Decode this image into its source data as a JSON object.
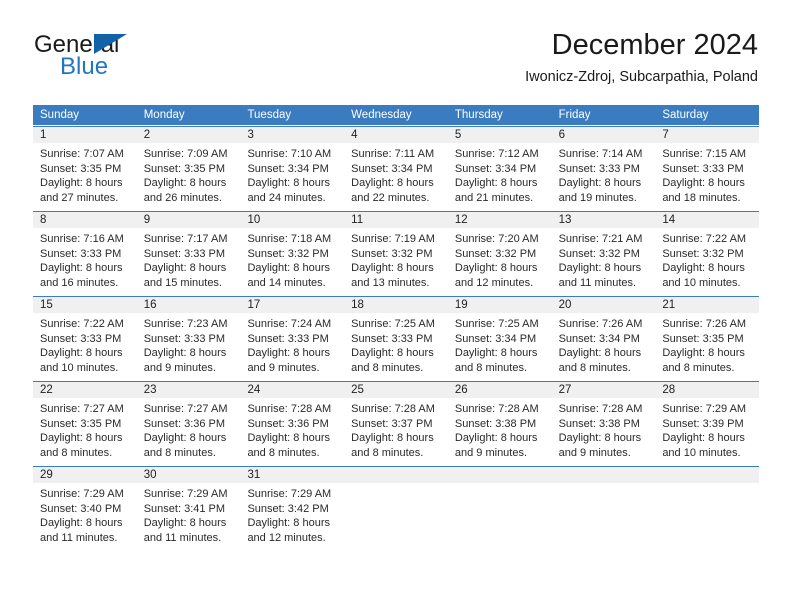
{
  "logo": {
    "word1": "General",
    "word2": "Blue",
    "triangle_icon": "triangle-icon",
    "color_dark": "#1a1a1a",
    "color_blue": "#1f77c4",
    "color_triangle": "#1262a8"
  },
  "header": {
    "title": "December 2024",
    "subtitle": "Iwonicz-Zdroj, Subcarpathia, Poland"
  },
  "theme": {
    "header_blue": "#3b7cc0",
    "daynum_bg": "#f0f0f0",
    "text": "#2a2a2a"
  },
  "calendar": {
    "weekday_headers": [
      "Sunday",
      "Monday",
      "Tuesday",
      "Wednesday",
      "Thursday",
      "Friday",
      "Saturday"
    ],
    "weeks": [
      [
        {
          "day": "1",
          "sunrise": "Sunrise: 7:07 AM",
          "sunset": "Sunset: 3:35 PM",
          "daylight1": "Daylight: 8 hours",
          "daylight2": "and 27 minutes."
        },
        {
          "day": "2",
          "sunrise": "Sunrise: 7:09 AM",
          "sunset": "Sunset: 3:35 PM",
          "daylight1": "Daylight: 8 hours",
          "daylight2": "and 26 minutes."
        },
        {
          "day": "3",
          "sunrise": "Sunrise: 7:10 AM",
          "sunset": "Sunset: 3:34 PM",
          "daylight1": "Daylight: 8 hours",
          "daylight2": "and 24 minutes."
        },
        {
          "day": "4",
          "sunrise": "Sunrise: 7:11 AM",
          "sunset": "Sunset: 3:34 PM",
          "daylight1": "Daylight: 8 hours",
          "daylight2": "and 22 minutes."
        },
        {
          "day": "5",
          "sunrise": "Sunrise: 7:12 AM",
          "sunset": "Sunset: 3:34 PM",
          "daylight1": "Daylight: 8 hours",
          "daylight2": "and 21 minutes."
        },
        {
          "day": "6",
          "sunrise": "Sunrise: 7:14 AM",
          "sunset": "Sunset: 3:33 PM",
          "daylight1": "Daylight: 8 hours",
          "daylight2": "and 19 minutes."
        },
        {
          "day": "7",
          "sunrise": "Sunrise: 7:15 AM",
          "sunset": "Sunset: 3:33 PM",
          "daylight1": "Daylight: 8 hours",
          "daylight2": "and 18 minutes."
        }
      ],
      [
        {
          "day": "8",
          "sunrise": "Sunrise: 7:16 AM",
          "sunset": "Sunset: 3:33 PM",
          "daylight1": "Daylight: 8 hours",
          "daylight2": "and 16 minutes."
        },
        {
          "day": "9",
          "sunrise": "Sunrise: 7:17 AM",
          "sunset": "Sunset: 3:33 PM",
          "daylight1": "Daylight: 8 hours",
          "daylight2": "and 15 minutes."
        },
        {
          "day": "10",
          "sunrise": "Sunrise: 7:18 AM",
          "sunset": "Sunset: 3:32 PM",
          "daylight1": "Daylight: 8 hours",
          "daylight2": "and 14 minutes."
        },
        {
          "day": "11",
          "sunrise": "Sunrise: 7:19 AM",
          "sunset": "Sunset: 3:32 PM",
          "daylight1": "Daylight: 8 hours",
          "daylight2": "and 13 minutes."
        },
        {
          "day": "12",
          "sunrise": "Sunrise: 7:20 AM",
          "sunset": "Sunset: 3:32 PM",
          "daylight1": "Daylight: 8 hours",
          "daylight2": "and 12 minutes."
        },
        {
          "day": "13",
          "sunrise": "Sunrise: 7:21 AM",
          "sunset": "Sunset: 3:32 PM",
          "daylight1": "Daylight: 8 hours",
          "daylight2": "and 11 minutes."
        },
        {
          "day": "14",
          "sunrise": "Sunrise: 7:22 AM",
          "sunset": "Sunset: 3:32 PM",
          "daylight1": "Daylight: 8 hours",
          "daylight2": "and 10 minutes."
        }
      ],
      [
        {
          "day": "15",
          "sunrise": "Sunrise: 7:22 AM",
          "sunset": "Sunset: 3:33 PM",
          "daylight1": "Daylight: 8 hours",
          "daylight2": "and 10 minutes."
        },
        {
          "day": "16",
          "sunrise": "Sunrise: 7:23 AM",
          "sunset": "Sunset: 3:33 PM",
          "daylight1": "Daylight: 8 hours",
          "daylight2": "and 9 minutes."
        },
        {
          "day": "17",
          "sunrise": "Sunrise: 7:24 AM",
          "sunset": "Sunset: 3:33 PM",
          "daylight1": "Daylight: 8 hours",
          "daylight2": "and 9 minutes."
        },
        {
          "day": "18",
          "sunrise": "Sunrise: 7:25 AM",
          "sunset": "Sunset: 3:33 PM",
          "daylight1": "Daylight: 8 hours",
          "daylight2": "and 8 minutes."
        },
        {
          "day": "19",
          "sunrise": "Sunrise: 7:25 AM",
          "sunset": "Sunset: 3:34 PM",
          "daylight1": "Daylight: 8 hours",
          "daylight2": "and 8 minutes."
        },
        {
          "day": "20",
          "sunrise": "Sunrise: 7:26 AM",
          "sunset": "Sunset: 3:34 PM",
          "daylight1": "Daylight: 8 hours",
          "daylight2": "and 8 minutes."
        },
        {
          "day": "21",
          "sunrise": "Sunrise: 7:26 AM",
          "sunset": "Sunset: 3:35 PM",
          "daylight1": "Daylight: 8 hours",
          "daylight2": "and 8 minutes."
        }
      ],
      [
        {
          "day": "22",
          "sunrise": "Sunrise: 7:27 AM",
          "sunset": "Sunset: 3:35 PM",
          "daylight1": "Daylight: 8 hours",
          "daylight2": "and 8 minutes."
        },
        {
          "day": "23",
          "sunrise": "Sunrise: 7:27 AM",
          "sunset": "Sunset: 3:36 PM",
          "daylight1": "Daylight: 8 hours",
          "daylight2": "and 8 minutes."
        },
        {
          "day": "24",
          "sunrise": "Sunrise: 7:28 AM",
          "sunset": "Sunset: 3:36 PM",
          "daylight1": "Daylight: 8 hours",
          "daylight2": "and 8 minutes."
        },
        {
          "day": "25",
          "sunrise": "Sunrise: 7:28 AM",
          "sunset": "Sunset: 3:37 PM",
          "daylight1": "Daylight: 8 hours",
          "daylight2": "and 8 minutes."
        },
        {
          "day": "26",
          "sunrise": "Sunrise: 7:28 AM",
          "sunset": "Sunset: 3:38 PM",
          "daylight1": "Daylight: 8 hours",
          "daylight2": "and 9 minutes."
        },
        {
          "day": "27",
          "sunrise": "Sunrise: 7:28 AM",
          "sunset": "Sunset: 3:38 PM",
          "daylight1": "Daylight: 8 hours",
          "daylight2": "and 9 minutes."
        },
        {
          "day": "28",
          "sunrise": "Sunrise: 7:29 AM",
          "sunset": "Sunset: 3:39 PM",
          "daylight1": "Daylight: 8 hours",
          "daylight2": "and 10 minutes."
        }
      ],
      [
        {
          "day": "29",
          "sunrise": "Sunrise: 7:29 AM",
          "sunset": "Sunset: 3:40 PM",
          "daylight1": "Daylight: 8 hours",
          "daylight2": "and 11 minutes."
        },
        {
          "day": "30",
          "sunrise": "Sunrise: 7:29 AM",
          "sunset": "Sunset: 3:41 PM",
          "daylight1": "Daylight: 8 hours",
          "daylight2": "and 11 minutes."
        },
        {
          "day": "31",
          "sunrise": "Sunrise: 7:29 AM",
          "sunset": "Sunset: 3:42 PM",
          "daylight1": "Daylight: 8 hours",
          "daylight2": "and 12 minutes."
        },
        {
          "day": "",
          "sunrise": "",
          "sunset": "",
          "daylight1": "",
          "daylight2": ""
        },
        {
          "day": "",
          "sunrise": "",
          "sunset": "",
          "daylight1": "",
          "daylight2": ""
        },
        {
          "day": "",
          "sunrise": "",
          "sunset": "",
          "daylight1": "",
          "daylight2": ""
        },
        {
          "day": "",
          "sunrise": "",
          "sunset": "",
          "daylight1": "",
          "daylight2": ""
        }
      ]
    ]
  }
}
